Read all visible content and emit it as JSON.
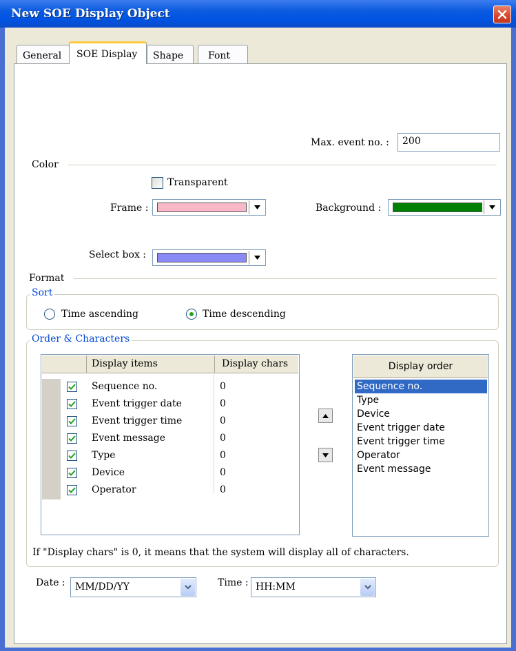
{
  "window": {
    "title": "New  SOE Display Object"
  },
  "tabs": [
    {
      "label": "General"
    },
    {
      "label": "SOE Display",
      "active": true
    },
    {
      "label": "Shape"
    },
    {
      "label": "Font"
    }
  ],
  "max_event": {
    "label": "Max. event no. :",
    "value": "200"
  },
  "color_section": {
    "heading": "Color",
    "transparent_label": "Transparent",
    "transparent_checked": false,
    "frame_label": "Frame :",
    "frame_color": "#f8b8c8",
    "background_label": "Background :",
    "background_color": "#008000",
    "select_box_label": "Select box :",
    "select_box_color": "#8a8af5"
  },
  "format_section": {
    "heading": "Format",
    "sort": {
      "title": "Sort",
      "options": [
        "Time ascending",
        "Time descending"
      ],
      "selected": "Time descending"
    },
    "order_group_title": "Order & Characters",
    "table": {
      "columns": [
        "Display items",
        "Display chars"
      ],
      "rows": [
        {
          "name": "Sequence no.",
          "chars": "0",
          "checked": true
        },
        {
          "name": "Event trigger date",
          "chars": "0",
          "checked": true
        },
        {
          "name": "Event trigger time",
          "chars": "0",
          "checked": true
        },
        {
          "name": "Event message",
          "chars": "0",
          "checked": true
        },
        {
          "name": "Type",
          "chars": "0",
          "checked": true
        },
        {
          "name": "Device",
          "chars": "0",
          "checked": true
        },
        {
          "name": "Operator",
          "chars": "0",
          "checked": true
        }
      ]
    },
    "display_order": {
      "title": "Display order",
      "items": [
        "Sequence no.",
        "Type",
        "Device",
        "Event trigger date",
        "Event trigger time",
        "Operator",
        "Event message"
      ],
      "selected_index": 0
    },
    "note": "If \"Display chars\" is 0, it means that the system will display all of  characters."
  },
  "date": {
    "label": "Date :",
    "value": "MM/DD/YY"
  },
  "time": {
    "label": "Time :",
    "value": "HH:MM"
  },
  "icons": [
    "close-icon",
    "dropdown-arrow-icon",
    "move-up-icon",
    "move-down-icon",
    "check-icon"
  ],
  "colors": {
    "titlebar": "#0054e3",
    "tab_highlight": "#ffc83c",
    "selection": "#316ac5",
    "group_title": "#0046d5"
  }
}
